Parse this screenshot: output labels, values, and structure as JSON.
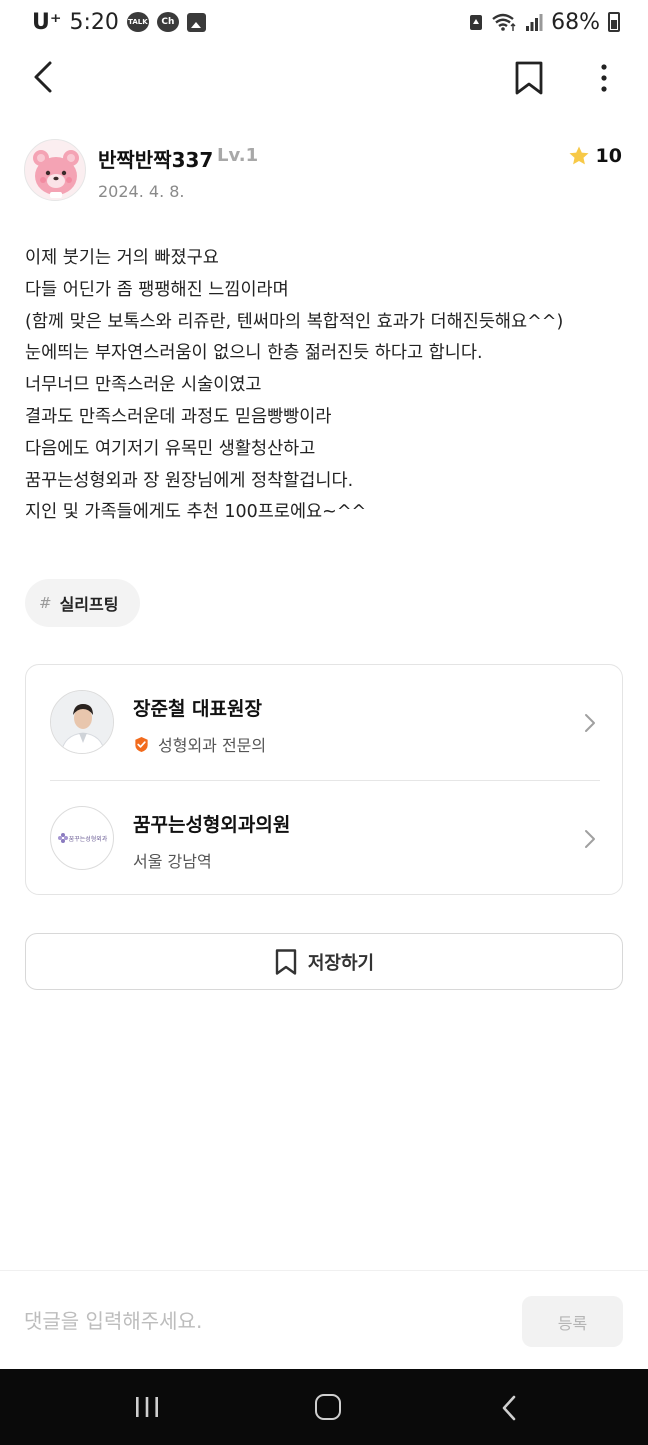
{
  "status_bar": {
    "carrier": "U⁺",
    "time": "5:20",
    "left_icons": [
      "talk-icon",
      "channel-icon",
      "gallery-icon"
    ],
    "talk_label": "TALK",
    "channel_label": "Ch",
    "battery": "68%"
  },
  "nav": {
    "icons": [
      "back-arrow-icon",
      "bookmark-icon",
      "more-vertical-icon"
    ]
  },
  "author": {
    "name": "반짝반짝337",
    "level": "Lv.1",
    "date": "2024. 4. 8.",
    "rating": "10",
    "rating_color": "#F7C948"
  },
  "review": {
    "text": "이제 붓기는 거의 빠졌구요\n다들 어딘가 좀 팽팽해진 느낌이라며\n(함께 맞은 보톡스와 리쥬란, 텐써마의 복합적인 효과가 더해진듯해요^^)\n눈에띄는 부자연스러움이 없으니 한층 젊러진듯 하다고 합니다.\n너무너므 만족스러운 시술이였고\n결과도 만족스러운데 과정도 믿음빵빵이라\n다음에도 여기저기 유목민 생활청산하고\n꿈꾸는성형외과 장 원장님에게 정착할겁니다.\n지인 및 가족들에게도 추천 100프로에요~^^"
  },
  "tag": {
    "hash": "#",
    "label": "실리프팅"
  },
  "doctor": {
    "name": "장준철 대표원장",
    "specialty": "성형외과 전문의",
    "verified_color": "#F26B1D"
  },
  "clinic": {
    "name": "꿈꾸는성형외과의원",
    "location": "서울 강남역",
    "logo_text": "꿈꾸는성형외과"
  },
  "save_button": {
    "label": "저장하기"
  },
  "comment": {
    "placeholder": "댓글을 입력해주세요.",
    "value": "",
    "submit_label": "등록"
  },
  "system_nav": {
    "icons": [
      "recents-icon",
      "home-icon",
      "system-back-icon"
    ]
  }
}
